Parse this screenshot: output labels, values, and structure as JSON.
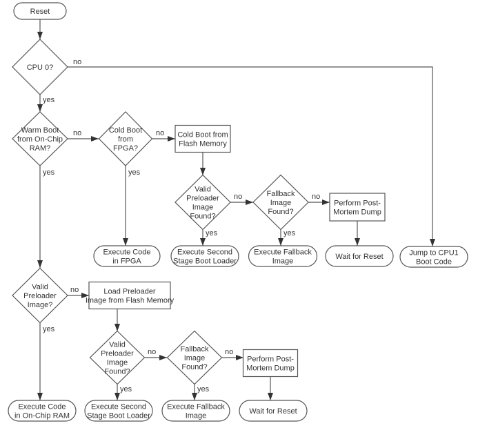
{
  "nodes": {
    "reset": [
      "Reset"
    ],
    "cpu0": [
      "CPU 0?"
    ],
    "warm_boot": [
      "Warm Boot",
      "from On-Chip",
      "RAM?"
    ],
    "cold_fpga": [
      "Cold Boot",
      "from",
      "FPGA?"
    ],
    "cold_flash": [
      "Cold Boot from",
      "Flash Memory"
    ],
    "valid_found_1": [
      "Valid",
      "Preloader",
      "Image",
      "Found?"
    ],
    "fallback_1": [
      "Fallback",
      "Image",
      "Found?"
    ],
    "postmortem_1": [
      "Perform Post-",
      "Mortem Dump"
    ],
    "exec_fpga": [
      "Execute Code",
      "in FPGA"
    ],
    "exec_second_1": [
      "Execute Second",
      "Stage Boot Loader"
    ],
    "exec_fallback_1": [
      "Execute Fallback",
      "Image"
    ],
    "wait_1": [
      "Wait for Reset"
    ],
    "jump_cpu1": [
      "Jump to CPU1",
      "Boot Code"
    ],
    "valid_image": [
      "Valid",
      "Preloader",
      "Image?"
    ],
    "load_preloader": [
      "Load Preloader",
      "Image from Flash Memory"
    ],
    "valid_found_2": [
      "Valid",
      "Preloader",
      "Image",
      "Found?"
    ],
    "fallback_2": [
      "Fallback",
      "Image",
      "Found?"
    ],
    "postmortem_2": [
      "Perform Post-",
      "Mortem Dump"
    ],
    "exec_ram": [
      "Execute Code",
      "in On-Chip RAM"
    ],
    "exec_second_2": [
      "Execute Second",
      "Stage Boot Loader"
    ],
    "exec_fallback_2": [
      "Execute Fallback",
      "Image"
    ],
    "wait_2": [
      "Wait for Reset"
    ]
  },
  "labels": {
    "yes": "yes",
    "no": "no"
  }
}
